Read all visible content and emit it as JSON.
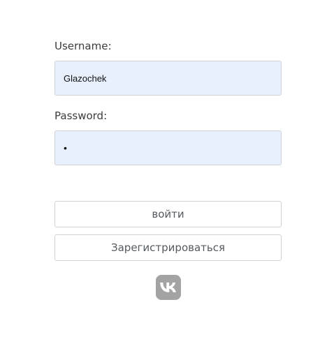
{
  "form": {
    "username_label": "Username:",
    "username_value": "Glazochek",
    "password_label": "Password:",
    "password_value": "•",
    "login_button": "войти",
    "register_button": "Зарегистрироваться",
    "vk_icon": "vk-logo-icon"
  },
  "colors": {
    "input_autofill_bg": "#e8f0fe",
    "border": "#cfd3d8",
    "vk_icon_bg": "#a3a3a3"
  }
}
